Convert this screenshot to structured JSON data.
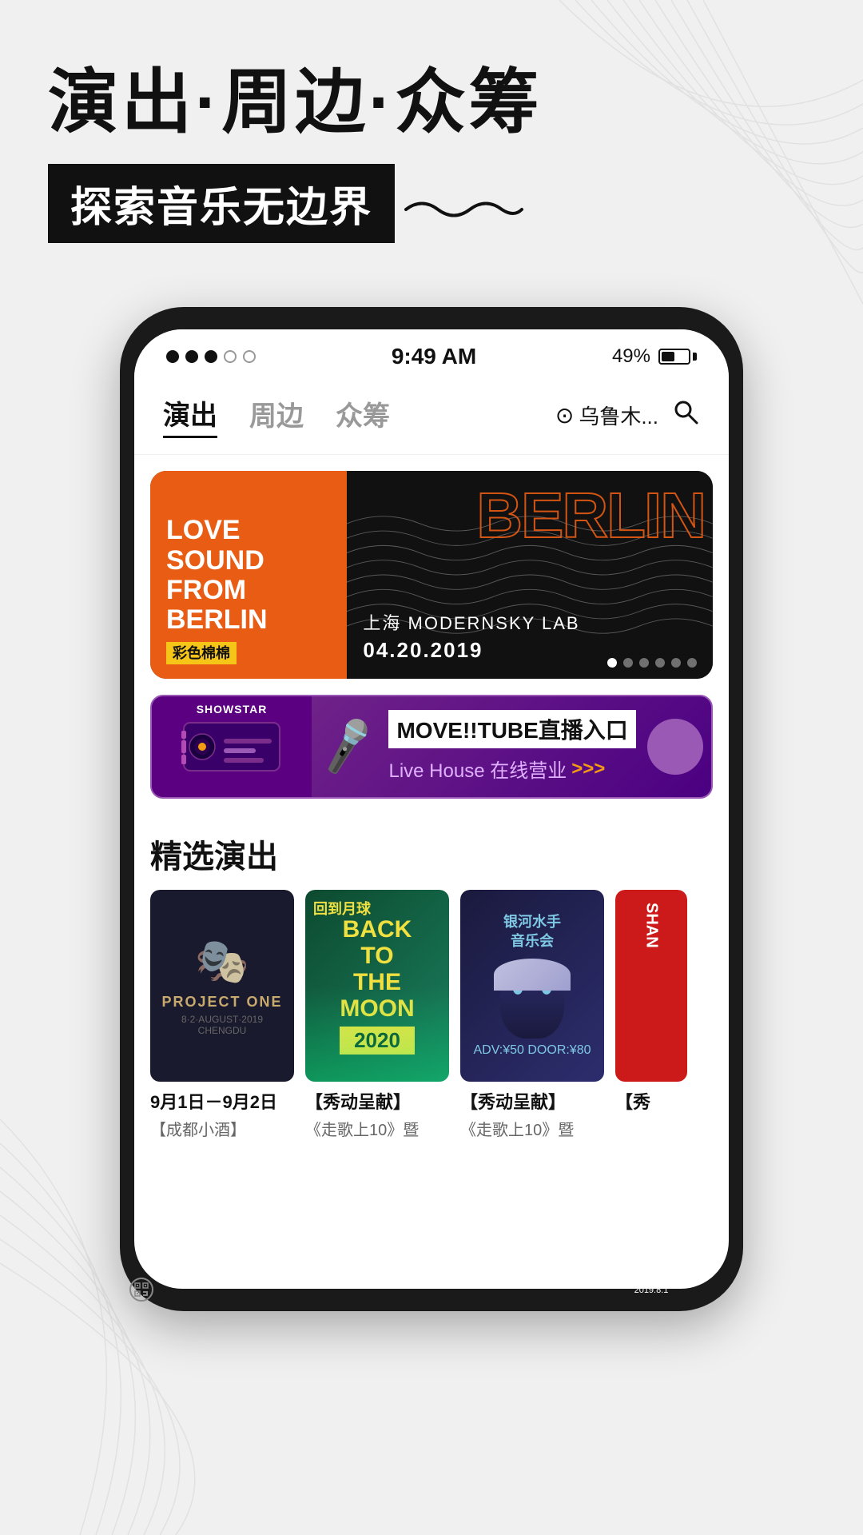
{
  "header": {
    "title": "演出·周边·众筹",
    "subtitle": "探索音乐无边界"
  },
  "statusBar": {
    "time": "9:49 AM",
    "battery": "49%",
    "dots": [
      "filled",
      "filled",
      "filled",
      "empty",
      "empty"
    ]
  },
  "navTabs": [
    {
      "label": "演出",
      "active": true
    },
    {
      "label": "周边",
      "active": false
    },
    {
      "label": "众筹",
      "active": false
    }
  ],
  "location": {
    "icon": "📍",
    "name": "乌鲁木..."
  },
  "banner": {
    "leftText": "LOVE\nSOUND\nFROM\nBERLIN",
    "brandLabel": "彩色棉棉",
    "berlinText": "BERLIN",
    "venue": "上海 MODERNSKY LAB",
    "date": "04.20.2019",
    "dots": [
      true,
      false,
      false,
      false,
      false,
      false
    ]
  },
  "liveBanner": {
    "showstarLabel": "SHOWSTAR",
    "title": "MOVE!!TUBE直播入口",
    "subtitle": "Live House 在线营业",
    "arrowsLabel": ">>>"
  },
  "sectionTitle": "精选演出",
  "events": [
    {
      "date": "9月1日－9月2日",
      "desc": "【成都小酒】",
      "posterType": "project-one",
      "posterTitle": "PROJECT ONE",
      "posterSub": "8·2·AUGUST·2019 CHENGDU"
    },
    {
      "date": "【秀动呈献】",
      "desc": "《走歌上10》暨",
      "posterType": "back-to-moon",
      "posterLabel": "回到月球",
      "posterTitle": "BACK\nTO\nTHE\nMOON"
    },
    {
      "date": "【秀动呈献】",
      "desc": "《走歌上10》暨",
      "posterType": "galaxy",
      "posterTitle": "银河水手音乐会"
    },
    {
      "date": "【秀",
      "desc": "",
      "posterType": "red",
      "posterTitle": "SHAN"
    }
  ],
  "icons": {
    "search": "🔍",
    "location": "📍",
    "mic": "🎤",
    "music": "🎵"
  }
}
